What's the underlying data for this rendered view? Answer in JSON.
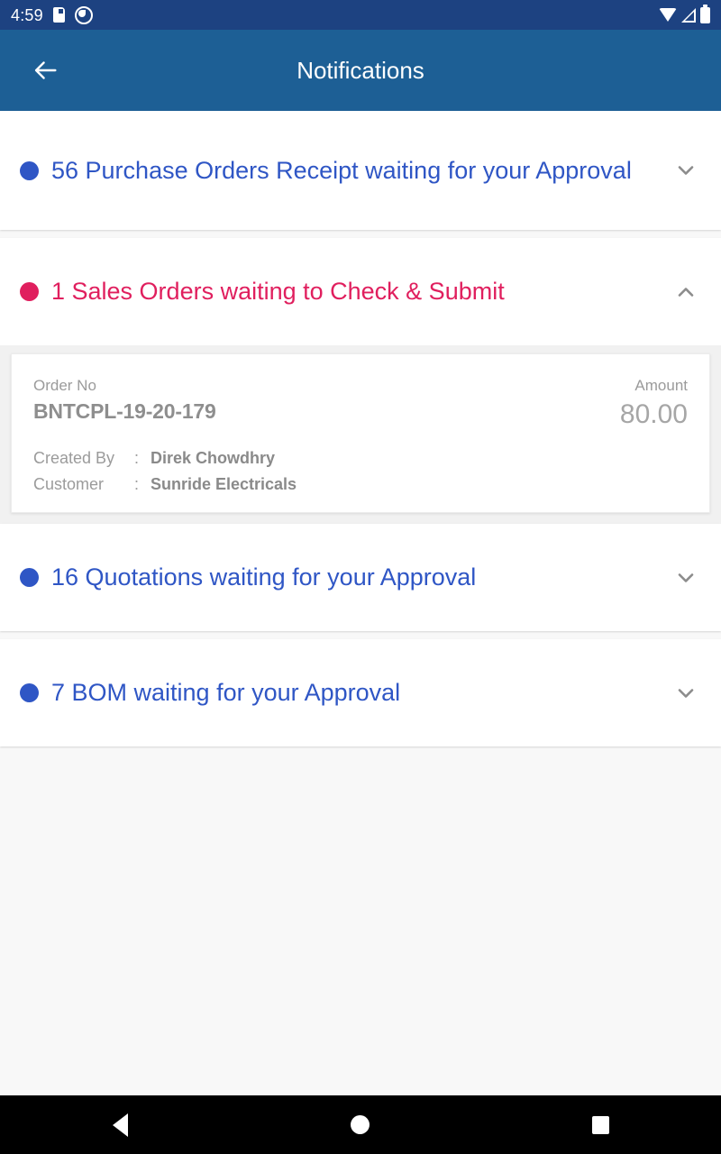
{
  "status_bar": {
    "time": "4:59",
    "icons_left": [
      "sd-card-icon",
      "do-not-disturb-icon"
    ],
    "icons_right": [
      "wifi-icon",
      "cellular-signal-icon",
      "battery-icon"
    ],
    "background_color": "#1d4281"
  },
  "app_bar": {
    "title": "Notifications",
    "back_icon": "arrow-left-icon",
    "background_color": "#1d5f95"
  },
  "colors": {
    "blue": "#2f56c5",
    "crimson": "#e01f5e",
    "chevron_grey": "#8c8c8c",
    "page_background": "#f8f8f8"
  },
  "notifications": [
    {
      "text": "56  Purchase Orders Receipt waiting for your Approval",
      "color": "#2f56c5",
      "expanded": false,
      "chevron": "chevron-down-icon",
      "lines": 2
    },
    {
      "text": "1 Sales Orders waiting to Check & Submit",
      "color": "#e01f5e",
      "expanded": true,
      "chevron": "chevron-up-icon",
      "lines": 1
    },
    {
      "text": "16 Quotations waiting for your Approval",
      "color": "#2f56c5",
      "expanded": false,
      "chevron": "chevron-down-icon",
      "lines": 1
    },
    {
      "text": "7 BOM waiting for your Approval",
      "color": "#2f56c5",
      "expanded": false,
      "chevron": "chevron-down-icon",
      "lines": 1
    }
  ],
  "detail_card": {
    "order_no_label": "Order No",
    "order_no_value": "BNTCPL-19-20-179",
    "amount_label": "Amount",
    "amount_value": "80.00",
    "created_by_label": "Created By",
    "created_by_colon": ":",
    "created_by_value": "Direk Chowdhry",
    "customer_label": "Customer",
    "customer_colon": ":",
    "customer_value": "Sunride Electricals"
  },
  "nav_bar": {
    "back": "back-triangle-icon",
    "home": "home-circle-icon",
    "recents": "recents-square-icon"
  }
}
